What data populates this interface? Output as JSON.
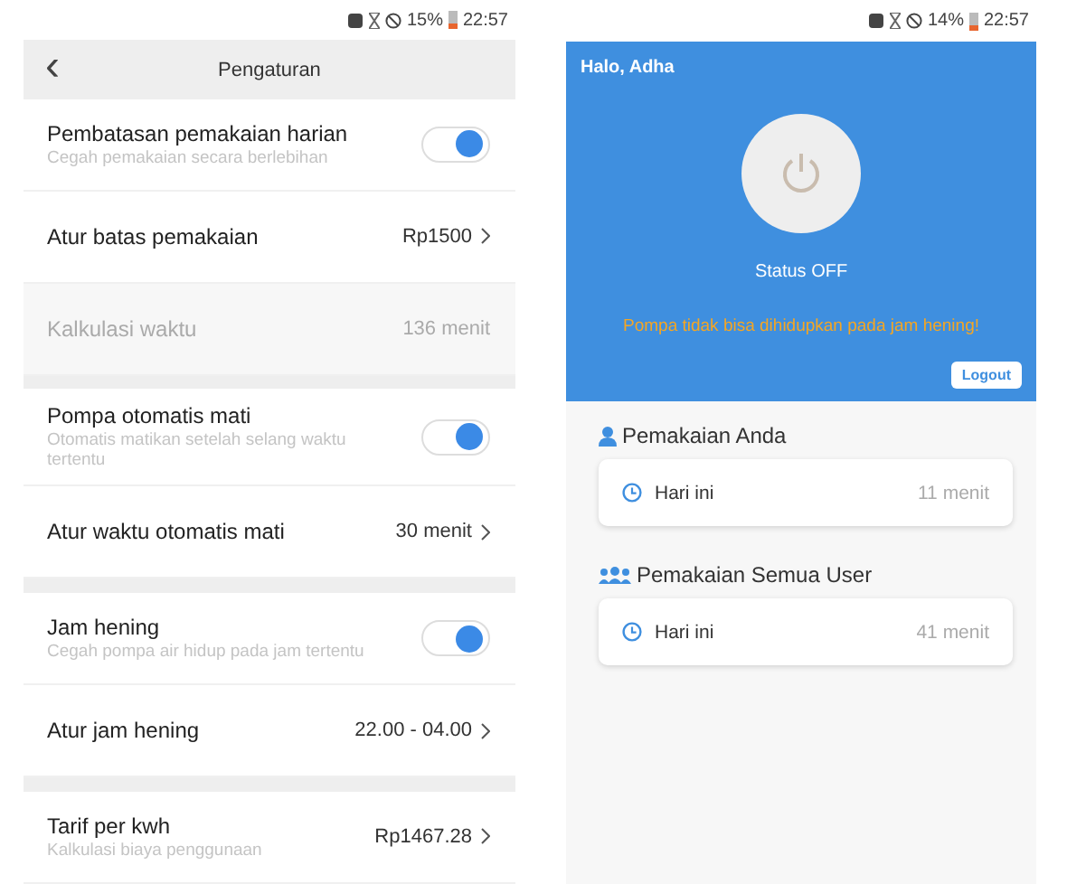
{
  "settings_screen": {
    "status_bar": {
      "battery": "15%",
      "time": "22:57"
    },
    "header": {
      "back": "‹",
      "title": "Pengaturan"
    },
    "sections": [
      {
        "items": [
          {
            "kind": "toggle",
            "label": "Pembatasan pemakaian harian",
            "subtitle": "Cegah pemakaian secara berlebihan",
            "on": true
          },
          {
            "kind": "link",
            "label": "Atur batas pemakaian",
            "value": "Rp1500"
          },
          {
            "kind": "info",
            "label": "Kalkulasi waktu",
            "value": "136 menit"
          }
        ]
      },
      {
        "items": [
          {
            "kind": "toggle",
            "label": "Pompa otomatis mati",
            "subtitle": "Otomatis matikan setelah selang waktu tertentu",
            "on": true
          },
          {
            "kind": "link",
            "label": "Atur waktu otomatis mati",
            "value": "30 menit"
          }
        ]
      },
      {
        "items": [
          {
            "kind": "toggle",
            "label": "Jam hening",
            "subtitle": "Cegah pompa air hidup pada jam tertentu",
            "on": true
          },
          {
            "kind": "link",
            "label": "Atur jam hening",
            "value": "22.00 - 04.00"
          }
        ]
      },
      {
        "items": [
          {
            "kind": "link",
            "label": "Tarif per kwh",
            "subtitle": "Kalkulasi biaya penggunaan",
            "value": "Rp1467.28"
          }
        ]
      }
    ]
  },
  "home_screen": {
    "status_bar": {
      "battery": "14%",
      "time": "22:57"
    },
    "greeting": "Halo, Adha",
    "pump_on": false,
    "status": "Status OFF",
    "warning": "Pompa tidak bisa dihidupkan pada jam hening!",
    "logout": "Logout",
    "usage": [
      {
        "kind": "user",
        "title": "Pemakaian Anda",
        "period": "Hari ini",
        "value": "11 menit"
      },
      {
        "kind": "group",
        "title": "Pemakaian Semua User",
        "period": "Hari ini",
        "value": "41 menit"
      }
    ]
  }
}
